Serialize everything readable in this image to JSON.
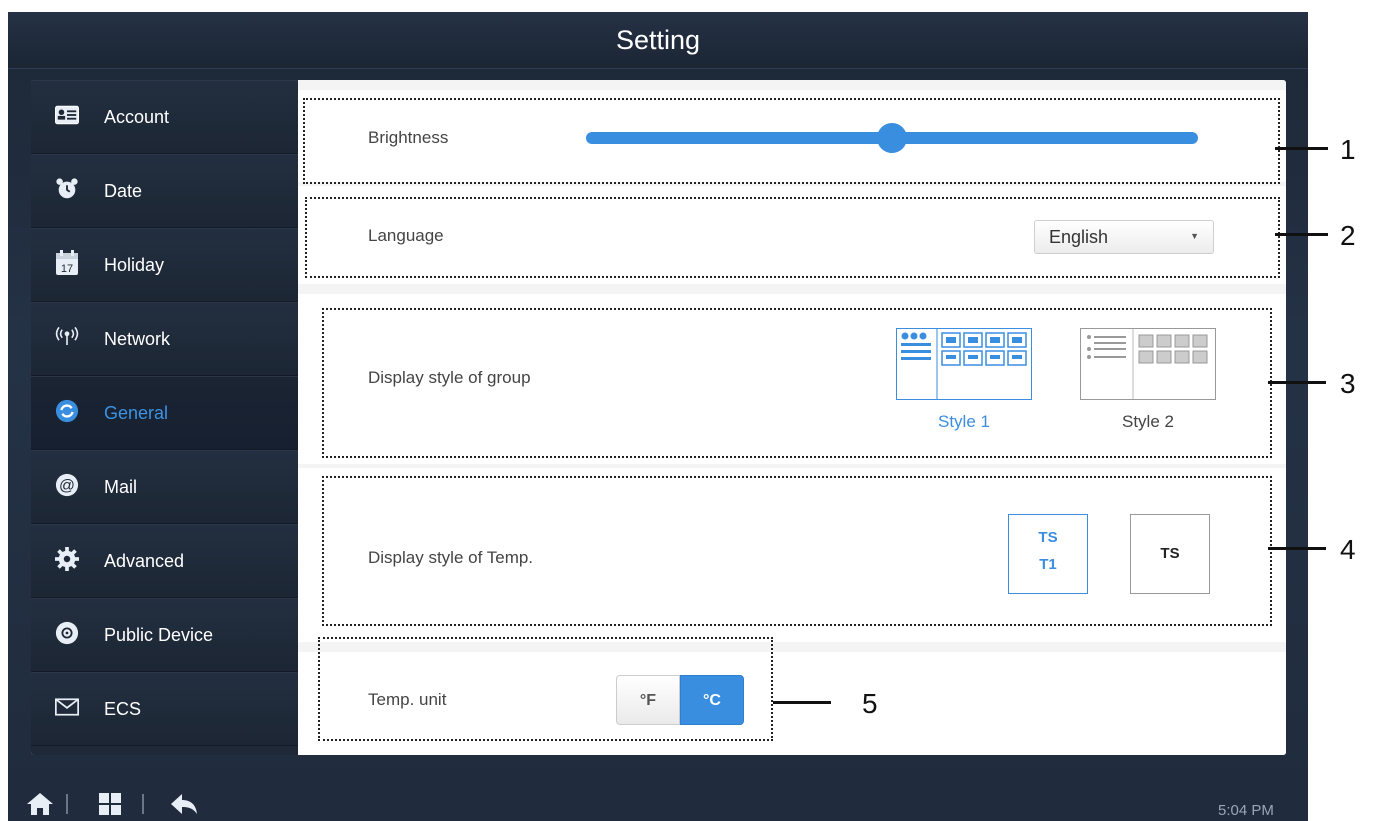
{
  "window": {
    "title": "Setting"
  },
  "sidebar": {
    "items": [
      {
        "label": "Account",
        "icon": "account-card-icon"
      },
      {
        "label": "Date",
        "icon": "alarm-clock-icon"
      },
      {
        "label": "Holiday",
        "icon": "calendar-icon",
        "icon_text": "17"
      },
      {
        "label": "Network",
        "icon": "antenna-icon"
      },
      {
        "label": "General",
        "icon": "general-sync-icon",
        "active": true
      },
      {
        "label": "Mail",
        "icon": "at-sign-icon"
      },
      {
        "label": "Advanced",
        "icon": "gear-icon"
      },
      {
        "label": "Public Device",
        "icon": "public-device-icon"
      },
      {
        "label": "ECS",
        "icon": "envelope-icon"
      }
    ]
  },
  "settings": {
    "brightness": {
      "label": "Brightness",
      "value_fraction": 0.5
    },
    "language": {
      "label": "Language",
      "selected": "English"
    },
    "group_style": {
      "label": "Display style of group",
      "options": [
        {
          "label": "Style 1",
          "selected": true
        },
        {
          "label": "Style 2",
          "selected": false
        }
      ]
    },
    "temp_style": {
      "label": "Display style of Temp.",
      "options": [
        {
          "line1": "TS",
          "line2": "T1",
          "selected": true
        },
        {
          "line1": "TS",
          "line2": "",
          "selected": false
        }
      ]
    },
    "temp_unit": {
      "label": "Temp. unit",
      "options": [
        {
          "label": "°F",
          "selected": false
        },
        {
          "label": "°C",
          "selected": true
        }
      ]
    }
  },
  "callouts": [
    "1",
    "2",
    "3",
    "4",
    "5"
  ],
  "footer": {
    "time": "5:04 PM"
  },
  "colors": {
    "accent": "#3a8ee0",
    "sidebar_bg": "#1e2837",
    "active_text": "#3c93e4"
  }
}
